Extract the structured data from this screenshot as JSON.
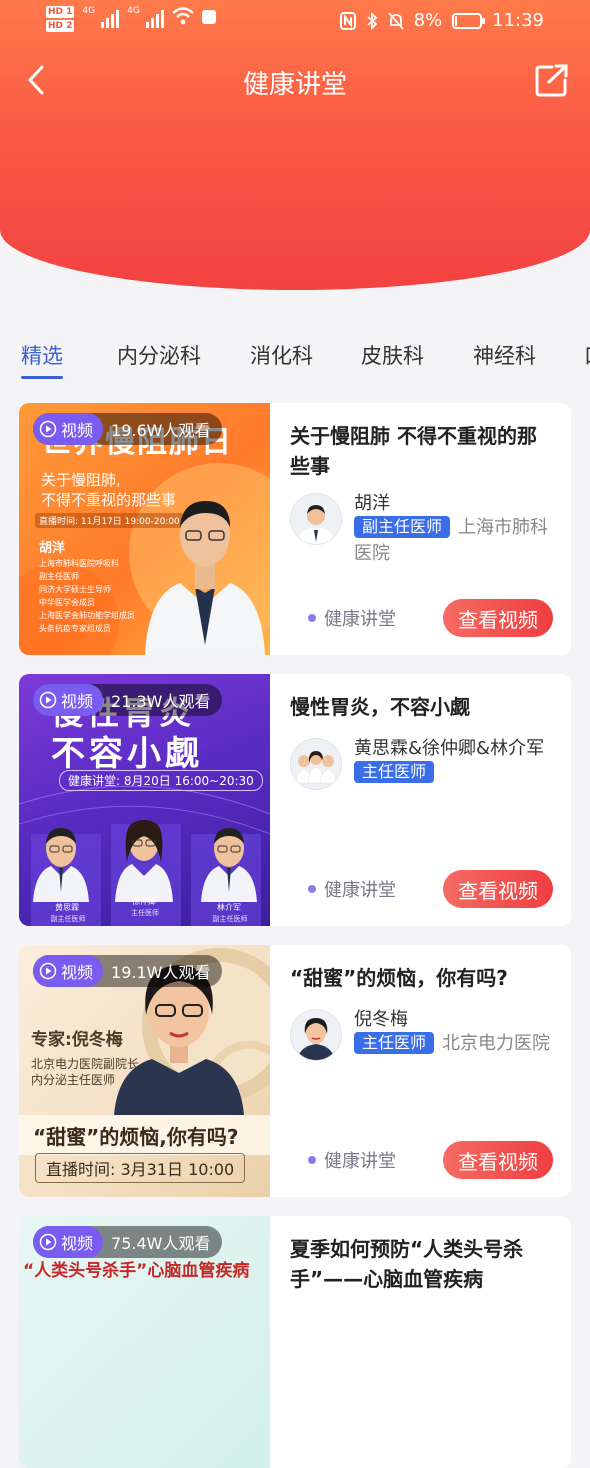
{
  "status": {
    "time": "11:39",
    "battery": "8%",
    "battery_level": 0.08,
    "hd1": "HD 1",
    "hd2": "HD 2",
    "net1": "4G",
    "net2": "4G"
  },
  "nav": {
    "title": "健康讲堂"
  },
  "tabs": [
    "精选",
    "内分泌科",
    "消化科",
    "皮肤科",
    "神经科",
    "口"
  ],
  "common": {
    "video_tag": "视频",
    "source": "健康讲堂",
    "watch_label": "查看视频"
  },
  "cards": [
    {
      "views": "19.6W人观看",
      "title": "关于慢阻肺 不得不重视的那些事",
      "doctor": "胡洋",
      "rank": "副主任医师",
      "hospital": "上海市肺科医院",
      "thumb": {
        "headline": "世界慢阻肺日",
        "sub1": "关于慢阻肺,",
        "sub2": "不得不重视的那些事",
        "time": "直播时间: 11月17日 19:00-20:00",
        "name": "胡洋",
        "lines": [
          "上海市肺科医院呼吸科",
          "副主任医师",
          "同济大学硕士生导师",
          "中华医学会成员",
          "上海医学会肺功能学组成员",
          "头条抗疫专家组成员"
        ]
      }
    },
    {
      "views": "21.3W人观看",
      "title": "慢性胃炎，不容小觑",
      "doctor": "黄思霖&徐仲卿&林介军",
      "rank": "主任医师",
      "hospital": "",
      "thumb": {
        "headline1": "慢性胃炎",
        "headline2": "不容小觑",
        "time": "健康讲堂: 8月20日 16:00~20:30",
        "names": [
          "黄思霖",
          "徐仲卿",
          "林介军"
        ],
        "roles": [
          "副主任医师",
          "主任医师",
          "副主任医师"
        ]
      }
    },
    {
      "views": "19.1W人观看",
      "title": "“甜蜜”的烦恼，你有吗?",
      "doctor": "倪冬梅",
      "rank": "主任医师",
      "hospital": "北京电力医院",
      "thumb": {
        "expert": "专家:倪冬梅",
        "org1": "北京电力医院副院长",
        "org2": "内分泌主任医师",
        "slogan": "“甜蜜”的烦恼,你有吗?",
        "time": "直播时间: 3月31日 10:00"
      }
    },
    {
      "views": "75.4W人观看",
      "title": "夏季如何预防“人类头号杀手”——心脑血管疾病",
      "thumb": {
        "slogan": "“人类头号杀手”心脑血管疾病"
      }
    }
  ]
}
